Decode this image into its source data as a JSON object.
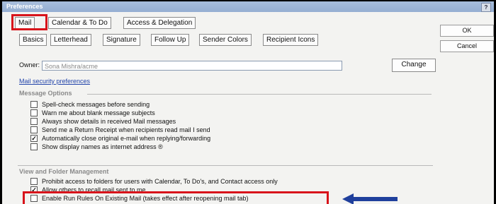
{
  "title": "Preferences",
  "help_glyph": "?",
  "main_tabs": [
    "Mail",
    "Calendar & To Do",
    "Access & Delegation"
  ],
  "sub_tabs": [
    "Basics",
    "Letterhead",
    "Signature",
    "Follow Up",
    "Sender Colors",
    "Recipient Icons"
  ],
  "side_buttons": {
    "ok": "OK",
    "cancel": "Cancel"
  },
  "owner": {
    "label": "Owner:",
    "value": "Sona Mishra/acme",
    "change_label": "Change"
  },
  "security_link": "Mail security preferences",
  "message_options": {
    "title": "Message Options",
    "items": [
      {
        "label": "Spell-check messages before sending",
        "checked": false
      },
      {
        "label": "Warn me about blank message subjects",
        "checked": false
      },
      {
        "label": "Always show details in received Mail messages",
        "checked": false
      },
      {
        "label": "Send me a Return Receipt when recipients read mail I send",
        "checked": false
      },
      {
        "label": "Automatically close original e-mail when replying/forwarding",
        "checked": true
      },
      {
        "label": "Show display names as internet address ®",
        "checked": false
      }
    ]
  },
  "view_folder": {
    "title": "View and Folder Management",
    "items": [
      {
        "label": "Prohibit access to folders for users with Calendar, To Do's, and Contact access only",
        "checked": false
      },
      {
        "label": "Allow others to recall mail sent to me",
        "checked": true
      },
      {
        "label": "Enable Run Rules On Existing Mail (takes effect after reopening mail tab)",
        "checked": false
      }
    ]
  },
  "colors": {
    "highlight": "#d8141b",
    "arrow": "#1f3f9c",
    "link": "#2244aa"
  },
  "icons": {
    "arrow": "left-arrow-icon",
    "check": "checkmark-icon"
  }
}
